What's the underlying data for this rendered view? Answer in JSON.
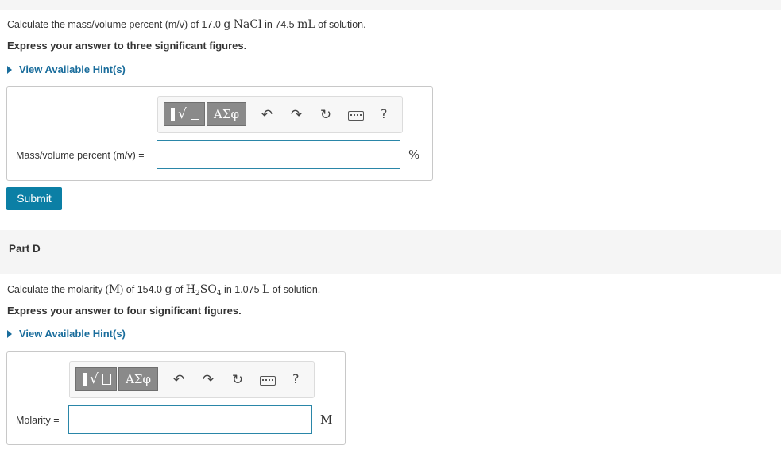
{
  "partC": {
    "question_prefix": "Calculate the mass/volume percent (m/v) of 17.0 ",
    "q_unit1": "g",
    "q_sub1": "NaCl",
    "q_mid": " in 74.5 ",
    "q_unit2": "mL",
    "q_suffix": " of solution.",
    "instruction": "Express your answer to three significant figures.",
    "hint_label": "View Available Hint(s)",
    "answer_label": "Mass/volume percent (m/v) =",
    "answer_value": "",
    "unit": "%",
    "submit_label": "Submit"
  },
  "partD": {
    "title": "Part D",
    "question_prefix": "Calculate the molarity (",
    "q_M": "M",
    "q_mid1": ") of 154.0 ",
    "q_g": "g",
    "q_of": " of ",
    "q_H": "H",
    "q_2": "2",
    "q_SO": "SO",
    "q_4": "4",
    "q_in": " in 1.075 ",
    "q_L": "L",
    "q_suffix": " of solution.",
    "instruction": "Express your answer to four significant figures.",
    "hint_label": "View Available Hint(s)",
    "answer_label": "Molarity =",
    "answer_value": "",
    "unit": "M"
  },
  "toolbar": {
    "greek_label": "ΑΣφ",
    "undo_icon": "↶",
    "redo_icon": "↷",
    "reset_icon": "↻",
    "help_label": "?"
  }
}
